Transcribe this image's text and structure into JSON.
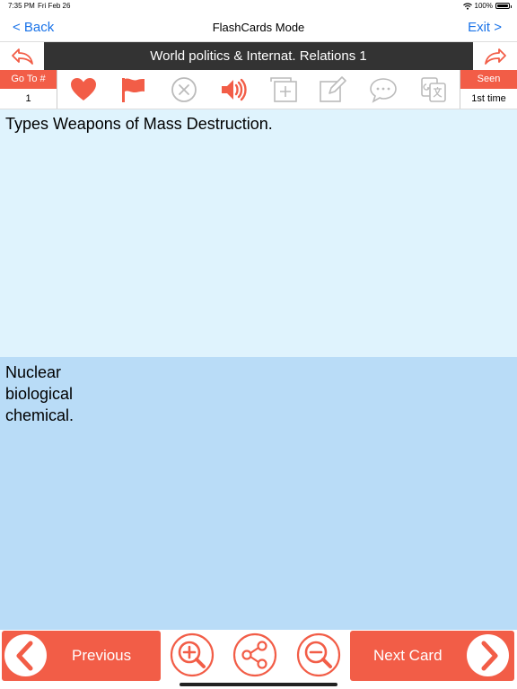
{
  "status_bar": {
    "time": "7:35 PM",
    "date": "Fri Feb 26",
    "battery": "100%"
  },
  "nav": {
    "back_label": "< Back",
    "title": "FlashCards Mode",
    "exit_label": "Exit >"
  },
  "deck": {
    "title": "World politics & Internat. Relations 1"
  },
  "toolbar": {
    "goto_label": "Go To #",
    "goto_value": "1",
    "seen_label": "Seen",
    "seen_value": "1st time",
    "icons": [
      "heart-icon",
      "flag-icon",
      "close-circle-icon",
      "speaker-icon",
      "add-card-icon",
      "edit-icon",
      "comment-search-icon",
      "translate-icon"
    ]
  },
  "card": {
    "question": "Types Weapons of Mass Destruction.",
    "answer_lines": [
      "Nuclear",
      "biological",
      "chemical."
    ]
  },
  "bottom": {
    "previous_label": "Previous",
    "next_label": "Next Card"
  },
  "colors": {
    "accent": "#f25d47",
    "link": "#1a73e8",
    "question_bg": "#dff3fd",
    "answer_bg": "#b9dcf7",
    "title_bg": "#333333",
    "inactive_icon": "#bbbbbb"
  }
}
